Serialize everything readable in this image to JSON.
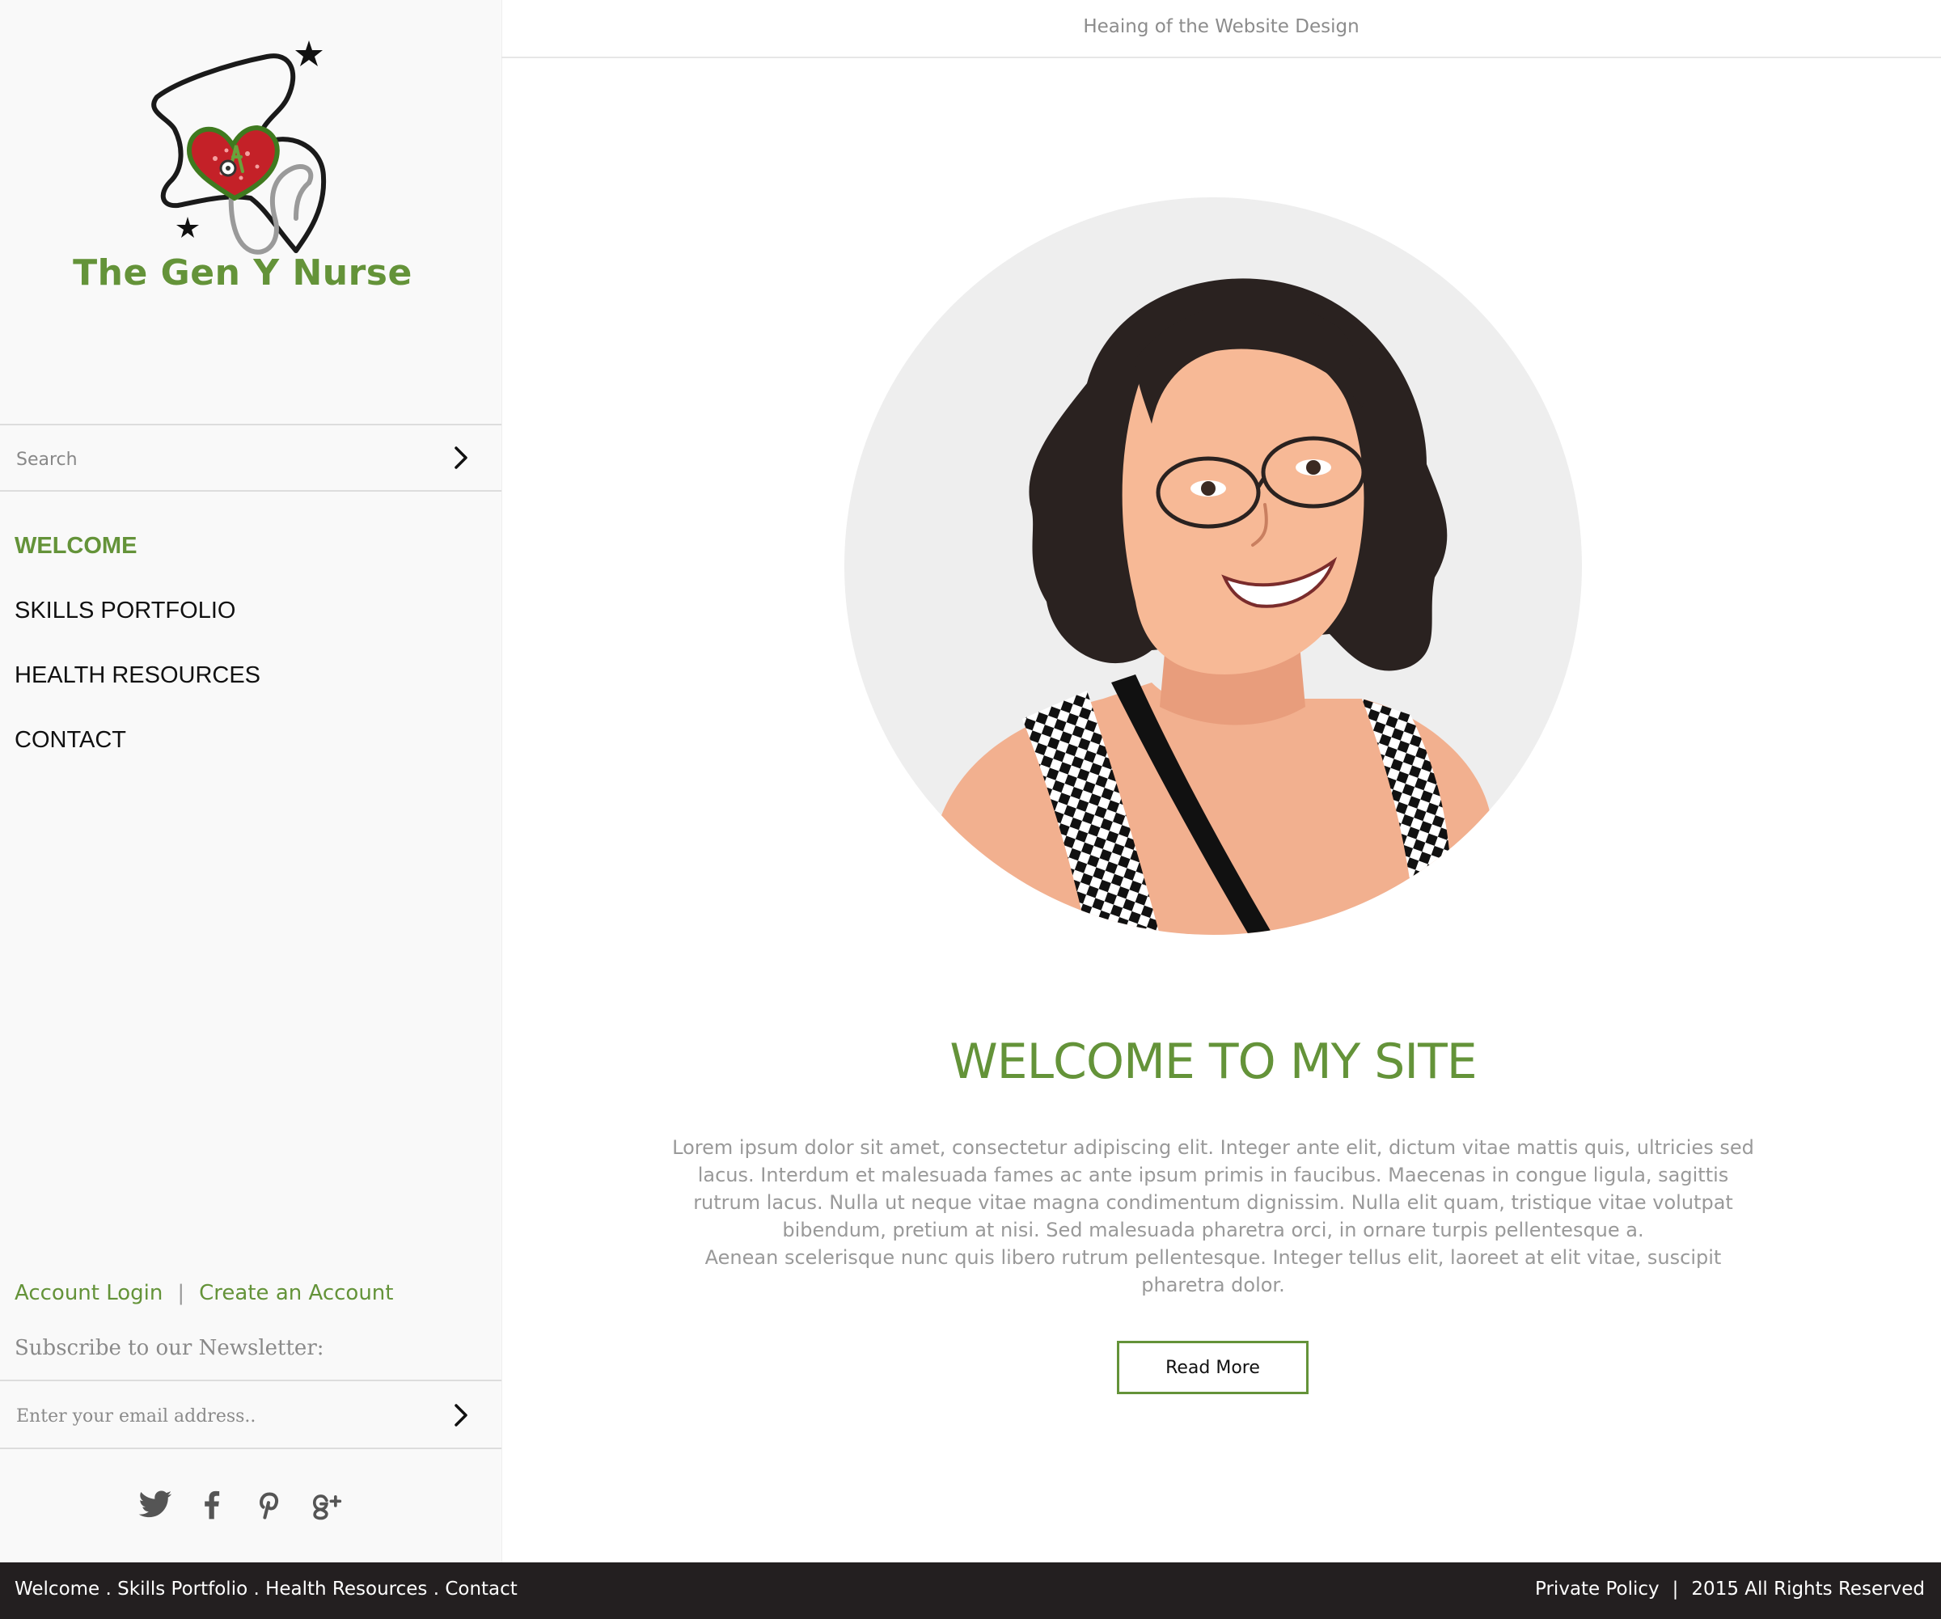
{
  "brand": {
    "name": "The Gen Y Nurse",
    "color": "#649339"
  },
  "header": {
    "text": "Heaing of the Website Design"
  },
  "sidebar": {
    "search": {
      "placeholder": "Search",
      "submit_icon": "chevron-right-icon"
    },
    "nav": [
      {
        "label": "WELCOME",
        "active": true
      },
      {
        "label": "SKILLS PORTFOLIO",
        "active": false
      },
      {
        "label": "HEALTH RESOURCES",
        "active": false
      },
      {
        "label": "CONTACT",
        "active": false
      }
    ],
    "account": {
      "login_label": "Account Login",
      "separator": "|",
      "create_label": "Create an Account"
    },
    "newsletter": {
      "label": "Subscribe to our Newsletter:",
      "placeholder": "Enter your email address..",
      "submit_icon": "chevron-right-icon"
    },
    "social": [
      "twitter-icon",
      "facebook-icon",
      "pinterest-icon",
      "google-plus-icon"
    ]
  },
  "main": {
    "heading": "WELCOME TO MY SITE",
    "paragraph_1": "Lorem ipsum dolor sit amet, consectetur adipiscing elit. Integer ante elit, dictum vitae mattis quis, ultricies sed lacus. Interdum et malesuada fames ac ante ipsum primis in faucibus. Maecenas in congue ligula, sagittis rutrum lacus. Nulla ut neque vitae magna condimentum dignissim. Nulla elit quam, tristique vitae volutpat bibendum, pretium at nisi. Sed malesuada pharetra orci, in ornare turpis pellentesque a.",
    "paragraph_2": "Aenean scelerisque nunc quis libero rutrum pellentesque. Integer tellus elit, laoreet at elit vitae, suscipit pharetra dolor.",
    "button_label": "Read More"
  },
  "footer": {
    "links": [
      {
        "label": "Welcome"
      },
      {
        "label": "Skills Portfolio"
      },
      {
        "label": "Health Resources"
      },
      {
        "label": "Contact"
      }
    ],
    "link_separator": " . ",
    "privacy_label": "Private Policy",
    "separator": "|",
    "copyright": "2015 All Rights Reserved"
  }
}
